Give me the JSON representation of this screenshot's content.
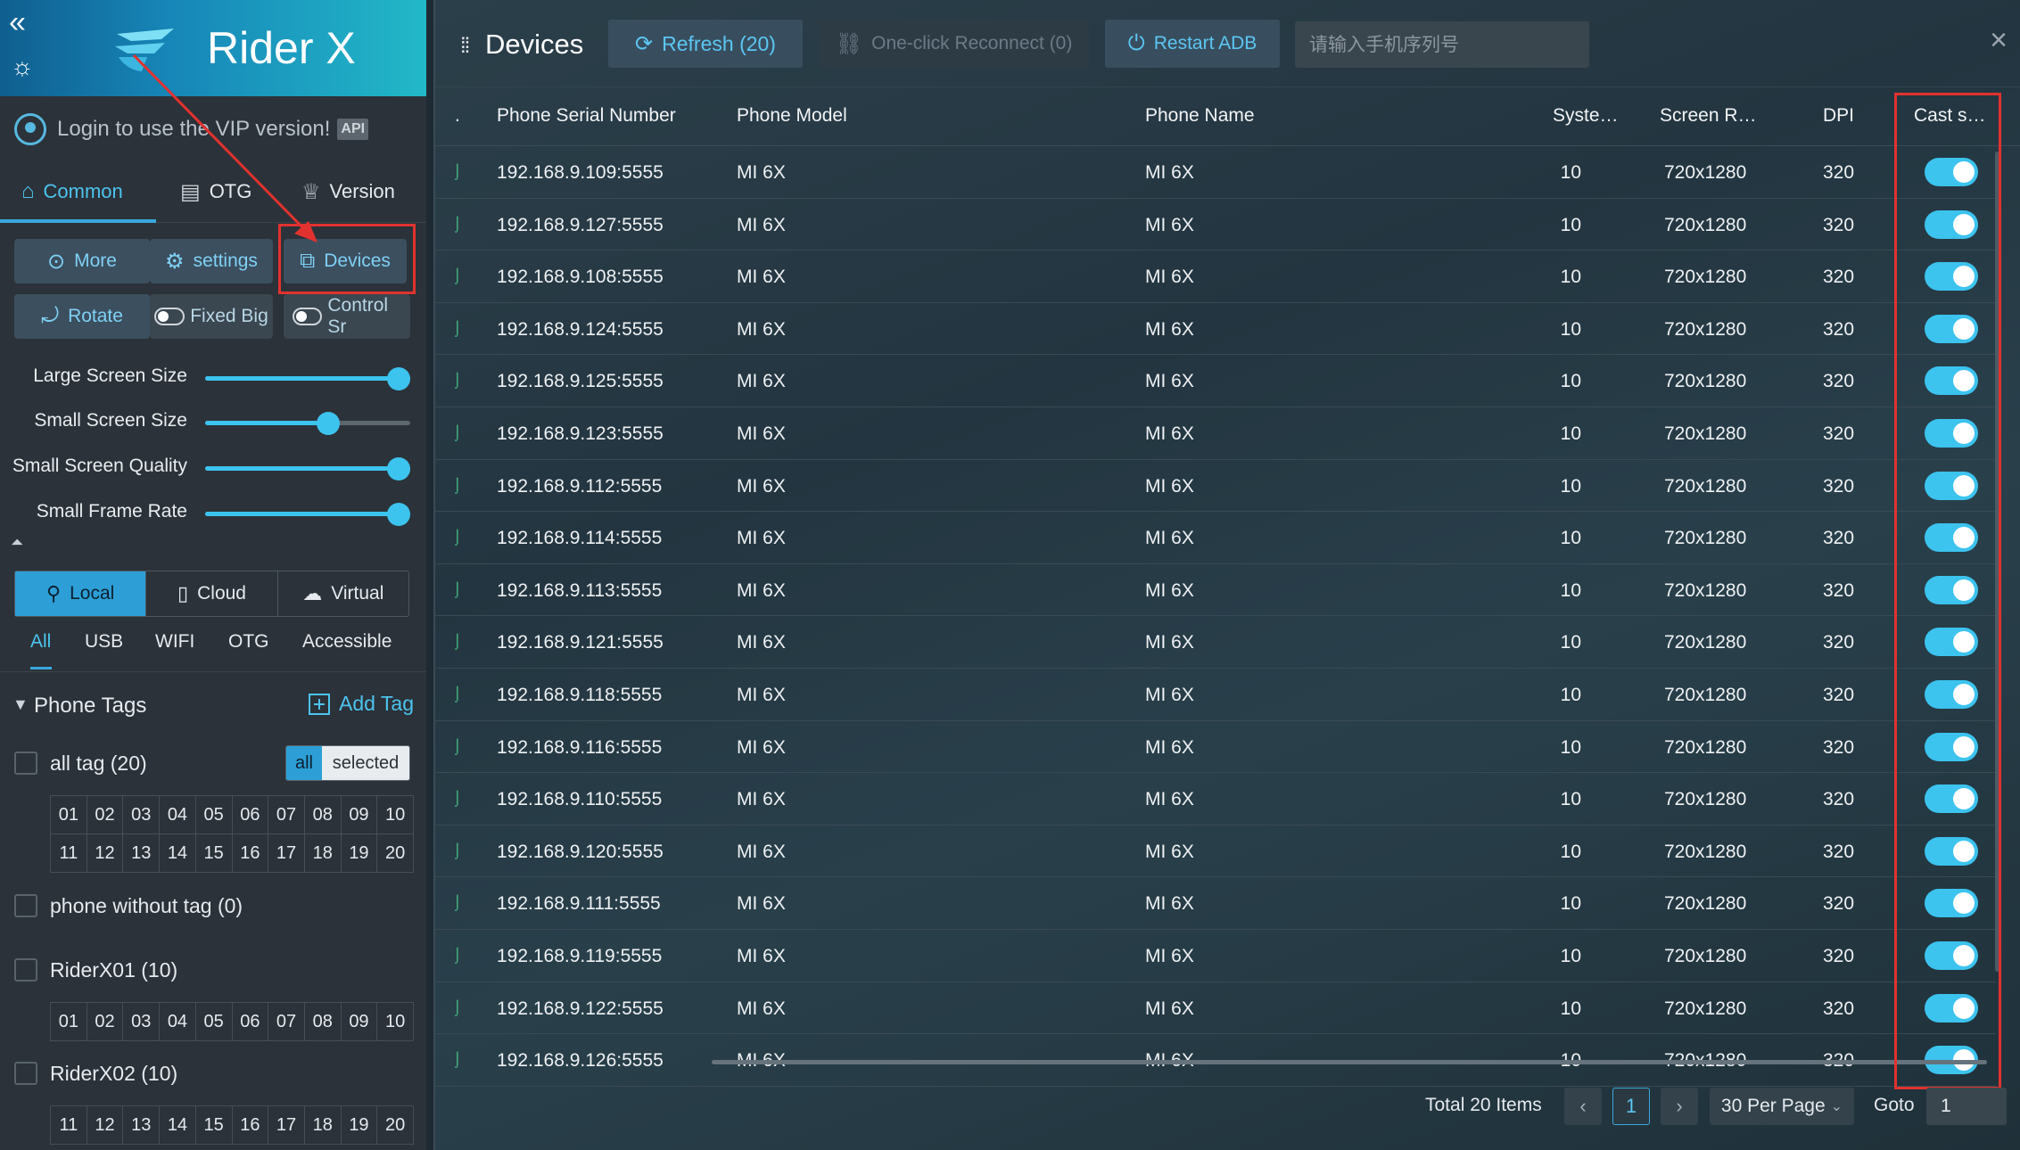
{
  "app": {
    "name": "Rider X"
  },
  "login": {
    "text": "Login to use the VIP version!",
    "badge": "API"
  },
  "main_tabs": [
    {
      "label": "Common",
      "icon": "home-icon",
      "active": true
    },
    {
      "label": "OTG",
      "icon": "otg-icon"
    },
    {
      "label": "Version",
      "icon": "crown-icon"
    }
  ],
  "toolbar": {
    "more": "More",
    "settings": "settings",
    "devices": "Devices",
    "rotate": "Rotate",
    "fixed_big": "Fixed Big",
    "control": "Control Sr"
  },
  "sliders": [
    {
      "label": "Large Screen Size",
      "value": 1.0
    },
    {
      "label": "Small Screen Size",
      "value": 0.6
    },
    {
      "label": "Small Screen Quality",
      "value": 1.0
    },
    {
      "label": "Small Frame Rate",
      "value": 1.0
    }
  ],
  "source_tabs": [
    {
      "label": "Local",
      "icon": "lock-icon",
      "active": true
    },
    {
      "label": "Cloud",
      "icon": "phone-icon"
    },
    {
      "label": "Virtual",
      "icon": "cloud-icon"
    }
  ],
  "conn_tabs": [
    "All",
    "USB",
    "WIFI",
    "OTG",
    "Accessible"
  ],
  "tags": {
    "title": "Phone Tags",
    "add_label": "Add Tag",
    "all_tag": "all tag (20)",
    "all_btn": "all",
    "selected_btn": "selected",
    "without_tag": "phone without tag (0)",
    "group1": "RiderX01 (10)",
    "group2": "RiderX02 (10)",
    "nums_1_10": [
      "01",
      "02",
      "03",
      "04",
      "05",
      "06",
      "07",
      "08",
      "09",
      "10"
    ],
    "nums_11_20": [
      "11",
      "12",
      "13",
      "14",
      "15",
      "16",
      "17",
      "18",
      "19",
      "20"
    ]
  },
  "devices_panel": {
    "title": "Devices",
    "refresh": "Refresh (20)",
    "reconnect": "One-click Reconnect (0)",
    "restart_adb": "Restart ADB",
    "search_placeholder": "请输入手机序列号",
    "close": "×",
    "columns": {
      "mark": ".",
      "serial": "Phone Serial Number",
      "model": "Phone Model",
      "name": "Phone Name",
      "system": "Syste…",
      "resolution": "Screen R…",
      "dpi": "DPI",
      "cast": "Cast s…"
    },
    "rows": [
      {
        "serial": "192.168.9.109:5555",
        "model": "MI 6X",
        "name": "MI 6X",
        "system": "10",
        "resolution": "720x1280",
        "dpi": "320",
        "cast": true
      },
      {
        "serial": "192.168.9.127:5555",
        "model": "MI 6X",
        "name": "MI 6X",
        "system": "10",
        "resolution": "720x1280",
        "dpi": "320",
        "cast": true
      },
      {
        "serial": "192.168.9.108:5555",
        "model": "MI 6X",
        "name": "MI 6X",
        "system": "10",
        "resolution": "720x1280",
        "dpi": "320",
        "cast": true
      },
      {
        "serial": "192.168.9.124:5555",
        "model": "MI 6X",
        "name": "MI 6X",
        "system": "10",
        "resolution": "720x1280",
        "dpi": "320",
        "cast": true
      },
      {
        "serial": "192.168.9.125:5555",
        "model": "MI 6X",
        "name": "MI 6X",
        "system": "10",
        "resolution": "720x1280",
        "dpi": "320",
        "cast": true
      },
      {
        "serial": "192.168.9.123:5555",
        "model": "MI 6X",
        "name": "MI 6X",
        "system": "10",
        "resolution": "720x1280",
        "dpi": "320",
        "cast": true
      },
      {
        "serial": "192.168.9.112:5555",
        "model": "MI 6X",
        "name": "MI 6X",
        "system": "10",
        "resolution": "720x1280",
        "dpi": "320",
        "cast": true
      },
      {
        "serial": "192.168.9.114:5555",
        "model": "MI 6X",
        "name": "MI 6X",
        "system": "10",
        "resolution": "720x1280",
        "dpi": "320",
        "cast": true
      },
      {
        "serial": "192.168.9.113:5555",
        "model": "MI 6X",
        "name": "MI 6X",
        "system": "10",
        "resolution": "720x1280",
        "dpi": "320",
        "cast": true
      },
      {
        "serial": "192.168.9.121:5555",
        "model": "MI 6X",
        "name": "MI 6X",
        "system": "10",
        "resolution": "720x1280",
        "dpi": "320",
        "cast": true
      },
      {
        "serial": "192.168.9.118:5555",
        "model": "MI 6X",
        "name": "MI 6X",
        "system": "10",
        "resolution": "720x1280",
        "dpi": "320",
        "cast": true
      },
      {
        "serial": "192.168.9.116:5555",
        "model": "MI 6X",
        "name": "MI 6X",
        "system": "10",
        "resolution": "720x1280",
        "dpi": "320",
        "cast": true
      },
      {
        "serial": "192.168.9.110:5555",
        "model": "MI 6X",
        "name": "MI 6X",
        "system": "10",
        "resolution": "720x1280",
        "dpi": "320",
        "cast": true
      },
      {
        "serial": "192.168.9.120:5555",
        "model": "MI 6X",
        "name": "MI 6X",
        "system": "10",
        "resolution": "720x1280",
        "dpi": "320",
        "cast": true
      },
      {
        "serial": "192.168.9.111:5555",
        "model": "MI 6X",
        "name": "MI 6X",
        "system": "10",
        "resolution": "720x1280",
        "dpi": "320",
        "cast": true
      },
      {
        "serial": "192.168.9.119:5555",
        "model": "MI 6X",
        "name": "MI 6X",
        "system": "10",
        "resolution": "720x1280",
        "dpi": "320",
        "cast": true
      },
      {
        "serial": "192.168.9.122:5555",
        "model": "MI 6X",
        "name": "MI 6X",
        "system": "10",
        "resolution": "720x1280",
        "dpi": "320",
        "cast": true
      },
      {
        "serial": "192.168.9.126:5555",
        "model": "MI 6X",
        "name": "MI 6X",
        "system": "10",
        "resolution": "720x1280",
        "dpi": "320",
        "cast": true
      }
    ],
    "pager": {
      "total": "Total 20 Items",
      "prev": "‹",
      "current": "1",
      "next": "›",
      "per_page": "30 Per Page",
      "goto_label": "Goto",
      "goto_value": "1"
    }
  },
  "colors": {
    "accent": "#3cc3ee",
    "highlight": "#e1322f"
  }
}
